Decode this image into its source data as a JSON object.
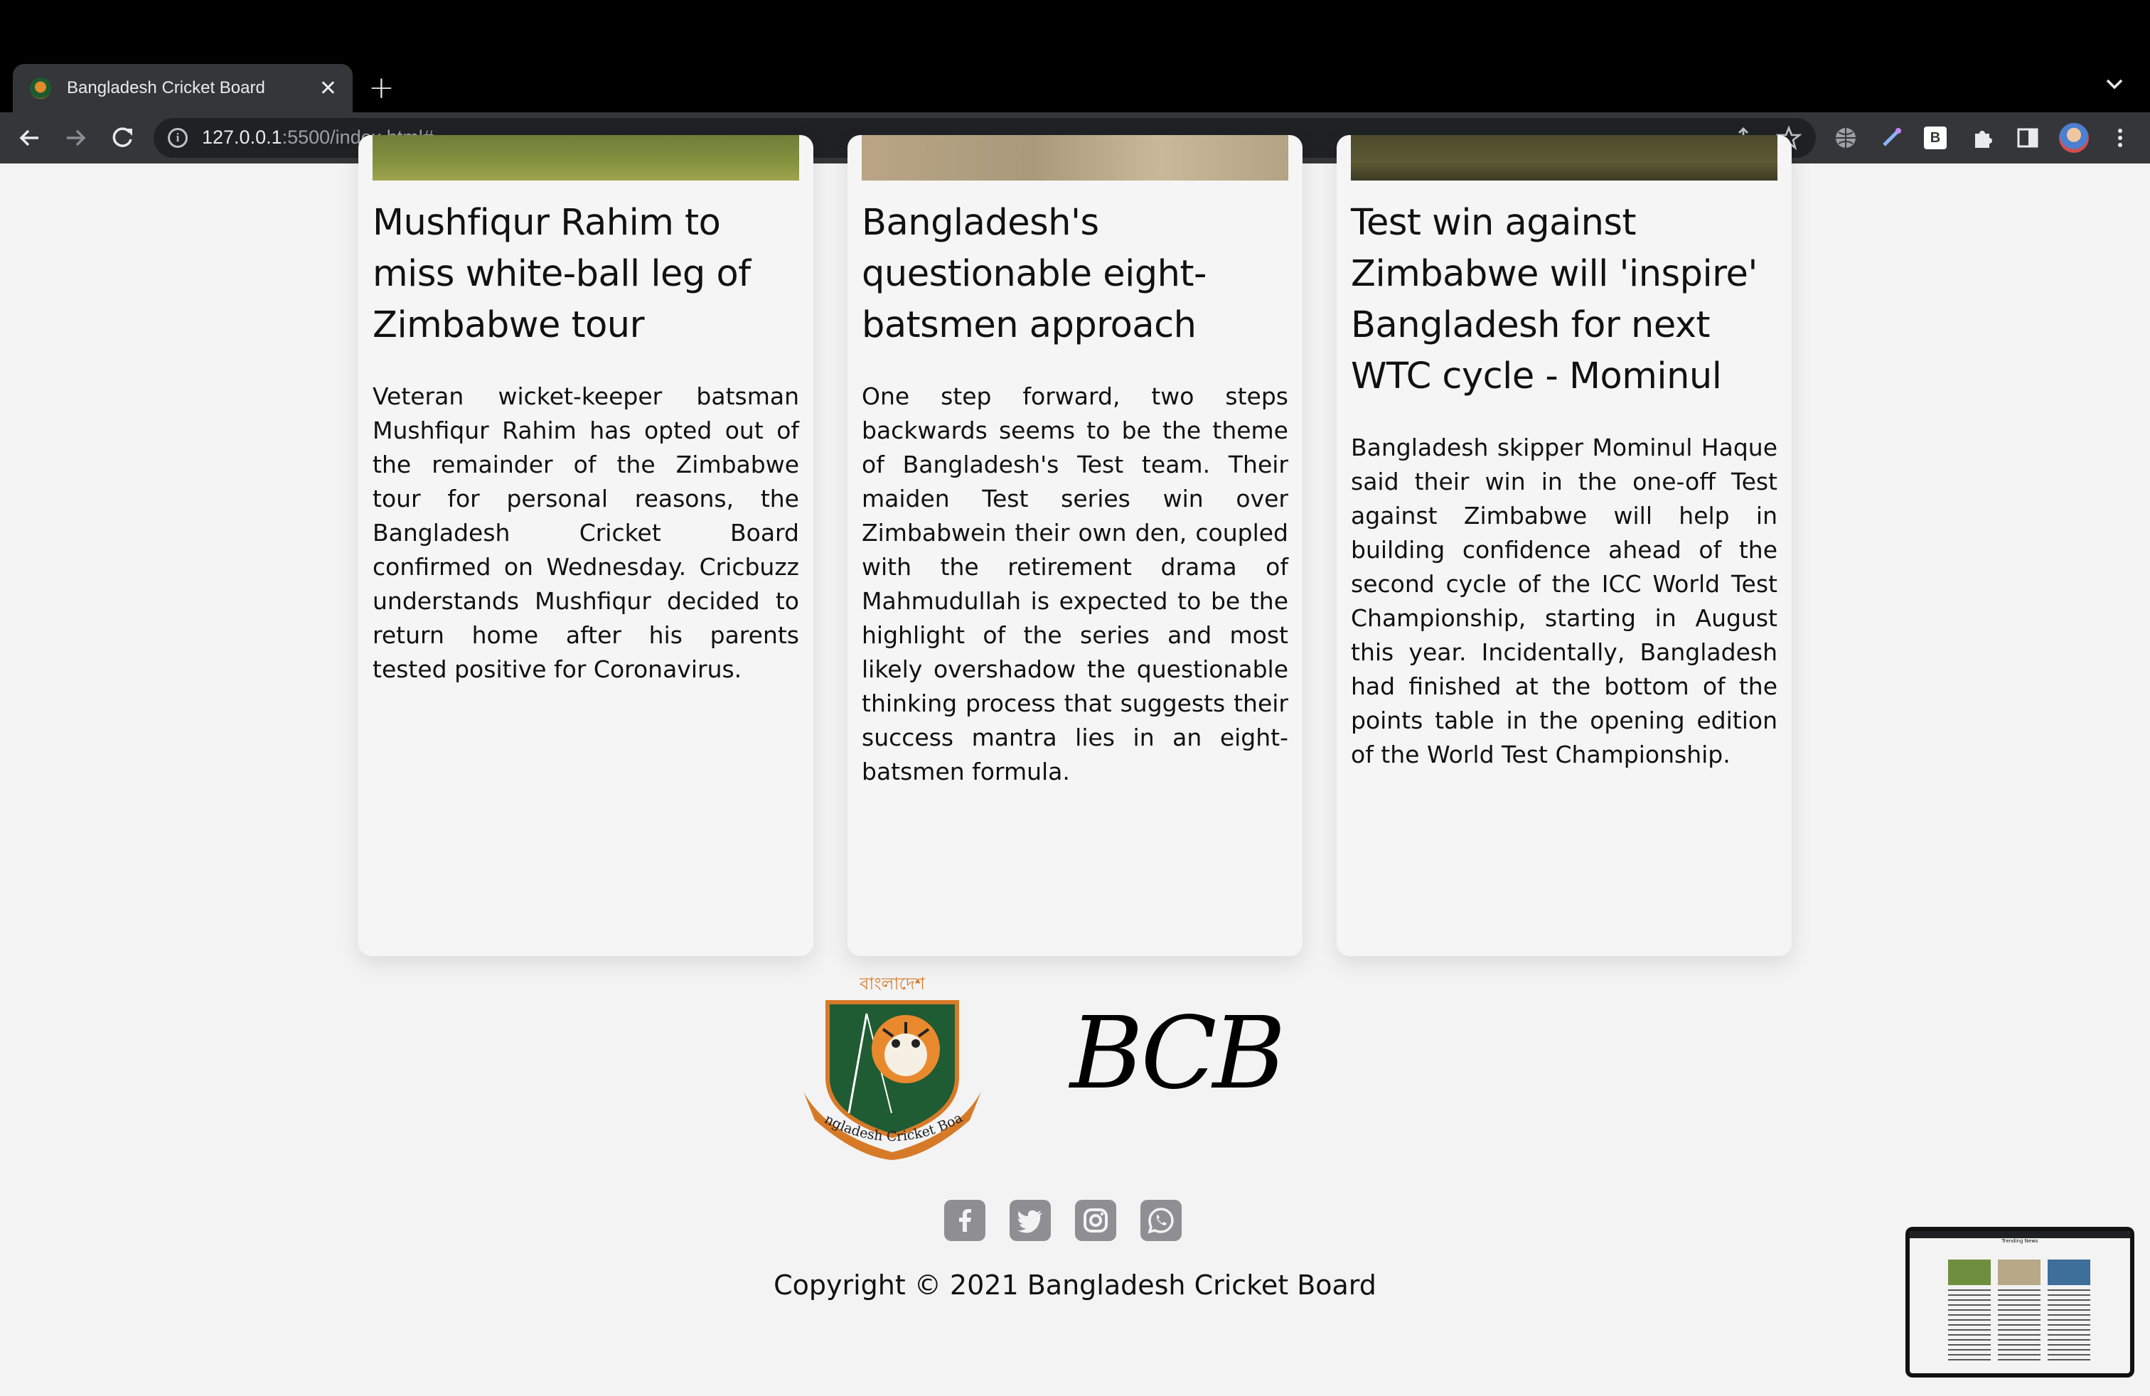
{
  "browser": {
    "tab_title": "Bangladesh Cricket Board",
    "url_host": "127.0.0.1",
    "url_rest": ":5500/index.html#"
  },
  "cards": [
    {
      "title": "Mushfiqur Rahim to miss white-ball leg of Zimbabwe tour",
      "body": "Veteran wicket-keeper batsman Mushfiqur Rahim has opted out of the remainder of the Zimbabwe tour for personal reasons, the Bangladesh Cricket Board confirmed on Wednesday. Cricbuzz understands Mushfiqur decided to return home after his parents tested positive for Coronavirus."
    },
    {
      "title": "Bangladesh's questionable eight-batsmen approach",
      "body": "One step forward, two steps backwards seems to be the theme of Bangladesh's Test team. Their maiden Test series win over Zimbabwein their own den, coupled with the retirement drama of Mahmudullah is expected to be the highlight of the series and most likely overshadow the questionable thinking process that suggests their success mantra lies in an eight-batsmen formula."
    },
    {
      "title": "Test win against Zimbabwe will 'inspire' Bangladesh for next WTC cycle - Mominul",
      "body": "Bangladesh skipper Mominul Haque said their win in the one-off Test against Zimbabwe will help in building confidence ahead of the second cycle of the ICC World Test Championship, starting in August this year. Incidentally, Bangladesh had finished at the bottom of the points table in the opening edition of the World Test Championship."
    }
  ],
  "footer": {
    "logo_top_text": "বাংলাদেশ",
    "logo_banner_text": "Bangladesh Cricket Board",
    "brand": "BCB",
    "socials": [
      "facebook-icon",
      "twitter-icon",
      "instagram-icon",
      "whatsapp-icon"
    ],
    "copyright": "Copyright © 2021 Bangladesh Cricket Board"
  },
  "thumbnail": {
    "heading": "Trending News"
  },
  "colors": {
    "page_bg": "#f3f3f3",
    "social_gray": "#8e8e93",
    "logo_green": "#1f5b33",
    "logo_orange": "#d77a28"
  }
}
